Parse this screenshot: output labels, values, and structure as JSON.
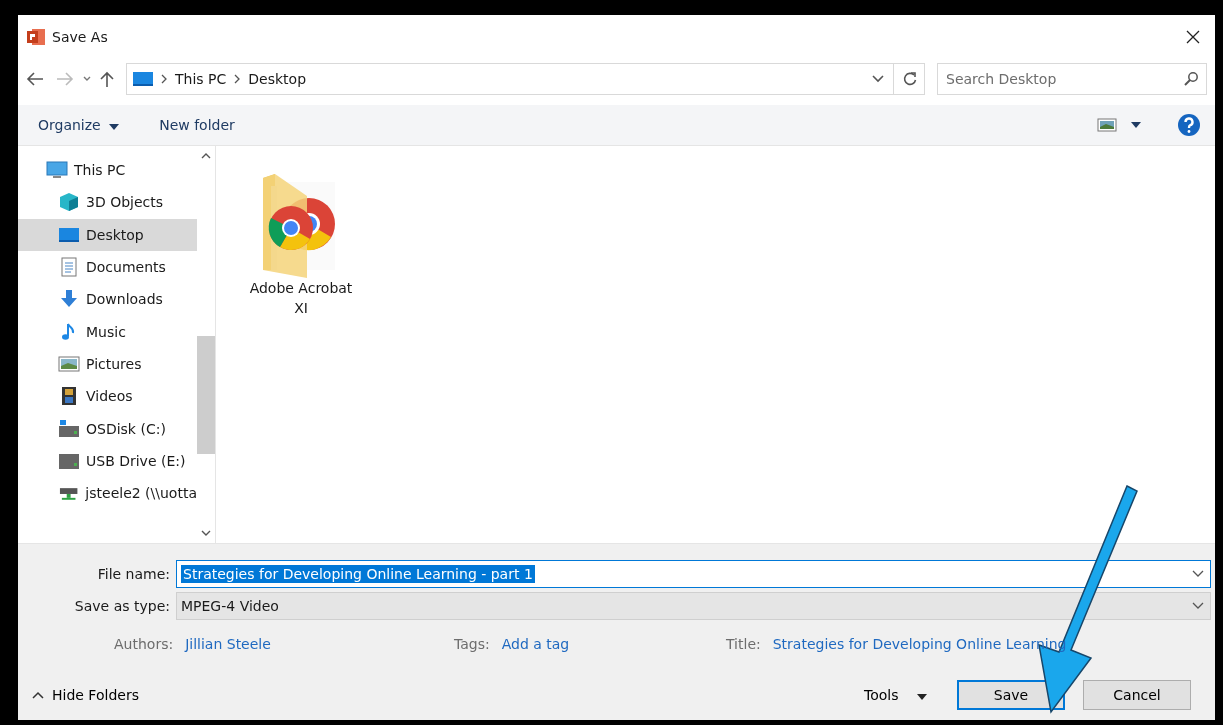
{
  "window": {
    "title": "Save As"
  },
  "breadcrumb": [
    "This PC",
    "Desktop"
  ],
  "search": {
    "placeholder": "Search Desktop"
  },
  "toolbar": {
    "organize": "Organize",
    "new_folder": "New folder"
  },
  "sidebar": {
    "items": [
      {
        "label": "This PC",
        "kind": "pc",
        "selected": false,
        "children": [
          {
            "label": "3D Objects",
            "kind": "cube",
            "selected": false
          },
          {
            "label": "Desktop",
            "kind": "desktop",
            "selected": true
          },
          {
            "label": "Documents",
            "kind": "doc",
            "selected": false
          },
          {
            "label": "Downloads",
            "kind": "download",
            "selected": false
          },
          {
            "label": "Music",
            "kind": "music",
            "selected": false
          },
          {
            "label": "Pictures",
            "kind": "picture",
            "selected": false
          },
          {
            "label": "Videos",
            "kind": "video",
            "selected": false
          },
          {
            "label": "OSDisk (C:)",
            "kind": "osdisk",
            "selected": false
          },
          {
            "label": "USB Drive (E:)",
            "kind": "drive",
            "selected": false
          },
          {
            "label": "jsteele2 (\\\\uotta",
            "kind": "network",
            "selected": false
          }
        ]
      }
    ]
  },
  "files": [
    {
      "name": "Adobe Acrobat XI"
    }
  ],
  "form": {
    "file_name_label": "File name:",
    "file_name": "Strategies for Developing Online Learning - part 1",
    "type_label": "Save as type:",
    "type": "MPEG-4 Video"
  },
  "meta": [
    {
      "label": "Authors:",
      "value": "Jillian Steele"
    },
    {
      "label": "Tags:",
      "value": "Add a tag"
    },
    {
      "label": "Title:",
      "value": "Strategies for Developing Online Learning"
    }
  ],
  "footer": {
    "hide_folders": "Hide Folders",
    "tools": "Tools",
    "save": "Save",
    "cancel": "Cancel"
  }
}
